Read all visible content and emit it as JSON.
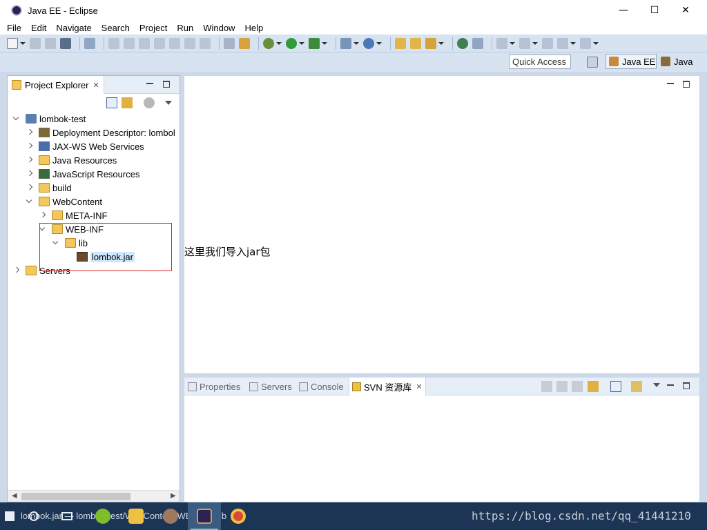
{
  "window": {
    "title": "Java EE - Eclipse",
    "controls": {
      "minimize": "—",
      "maximize": "☐",
      "close": "✕"
    }
  },
  "menu": [
    "File",
    "Edit",
    "Navigate",
    "Search",
    "Project",
    "Run",
    "Window",
    "Help"
  ],
  "perspective_bar": {
    "quick_access": "Quick Access",
    "perspectives": [
      "Java EE",
      "Java"
    ]
  },
  "explorer": {
    "tab_label": "Project Explorer",
    "tree": [
      {
        "label": "lombok-test",
        "expanded": true
      },
      {
        "label": "Deployment Descriptor: lombol"
      },
      {
        "label": "JAX-WS Web Services"
      },
      {
        "label": "Java Resources"
      },
      {
        "label": "JavaScript Resources"
      },
      {
        "label": "build"
      },
      {
        "label": "WebContent",
        "expanded": true
      },
      {
        "label": "META-INF"
      },
      {
        "label": "WEB-INF",
        "expanded": true
      },
      {
        "label": "lib",
        "expanded": true
      },
      {
        "label": "lombok.jar",
        "selected": true
      },
      {
        "label": "Servers"
      }
    ]
  },
  "editor": {
    "annotation": "这里我们导入jar包"
  },
  "bottom_panel": {
    "tabs": [
      "Properties",
      "Servers",
      "Console",
      "SVN 资源库"
    ],
    "active_tab": "SVN 资源库"
  },
  "taskbar": {
    "label": "lombok.jar — lombok-test/WebContent/WEB-INF/lib",
    "watermark": "https://blog.csdn.net/qq_41441210"
  },
  "colors": {
    "titlebar_bg": "#ffffff",
    "workbench_bg": "#cdd9e9",
    "highlight_border": "#e02020",
    "selection_bg": "#cde8ff",
    "taskbar_bg": "#1c3555"
  }
}
